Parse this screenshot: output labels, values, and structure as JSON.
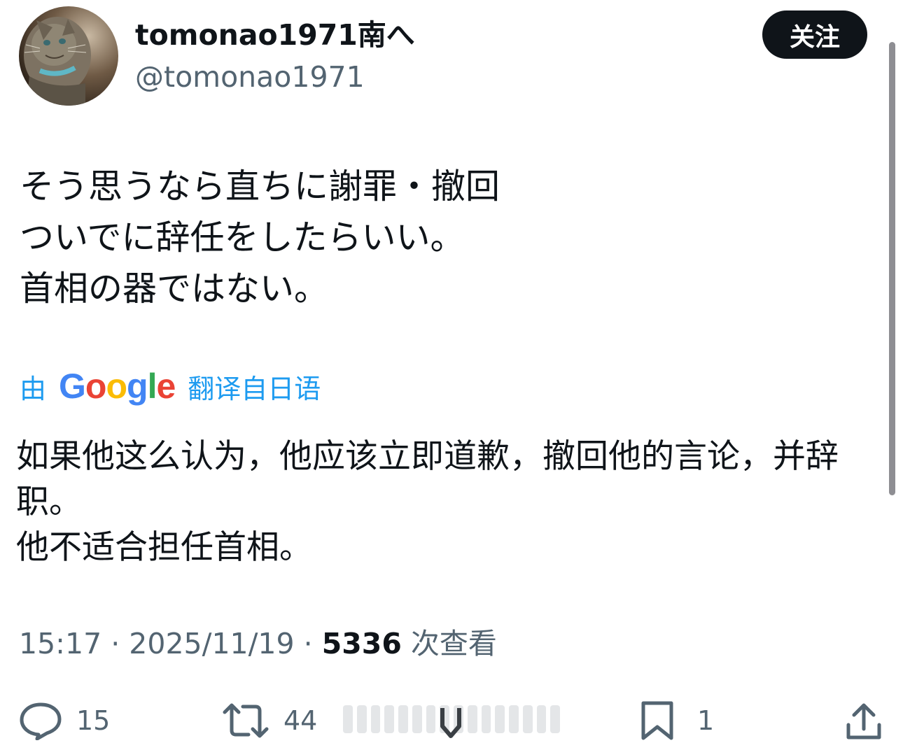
{
  "author": {
    "display_name": "tomonao1971南へ",
    "handle": "@tomonao1971",
    "follow_label": "关注"
  },
  "tweet": {
    "lines": [
      "そう思うなら直ちに謝罪・撤回",
      "ついでに辞任をしたらいい。",
      "首相の器ではない。"
    ]
  },
  "translation": {
    "prefix": "由",
    "google": [
      "G",
      "o",
      "o",
      "g",
      "l",
      "e"
    ],
    "suffix": "翻译自日语",
    "lines": [
      "如果他这么认为，他应该立即道歉，撤回他的言论，并辞",
      "职。",
      "他不适合担任首相。"
    ]
  },
  "meta": {
    "time": "15:17",
    "sep1": "·",
    "date": "2025/11/19",
    "sep2": "·",
    "views": "5336",
    "views_label": "次查看"
  },
  "actions": {
    "reply_count": "15",
    "retweet_count": "44",
    "bookmark_count": "1"
  },
  "colors": {
    "accent": "#1d9bf0",
    "text": "#0f1419",
    "muted": "#536471",
    "google_blue": "#4285F4",
    "google_red": "#EA4335",
    "google_yellow": "#FBBC05",
    "google_green": "#34A853"
  },
  "icons": [
    "reply-icon",
    "retweet-icon",
    "views-icon",
    "bookmark-icon",
    "share-icon"
  ]
}
